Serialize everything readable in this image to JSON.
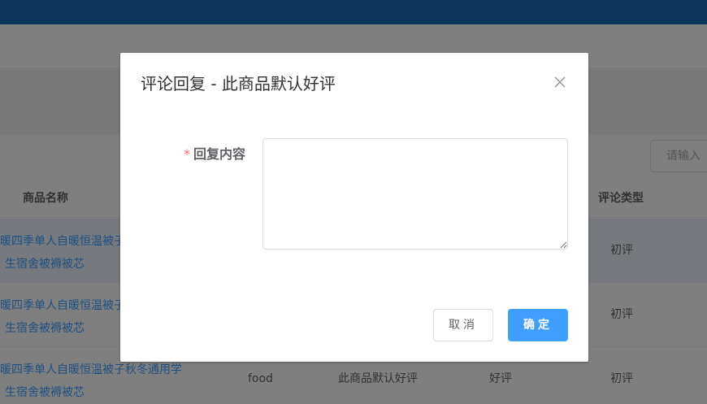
{
  "search": {
    "placeholder": "请输入"
  },
  "table": {
    "headers": {
      "product_name": "商品名称",
      "review_type": "评论类型"
    },
    "rows": [
      {
        "name_line1": "暖四季单人自暖恒温被子",
        "name_line2": "生宿舍被褥被芯",
        "category": "",
        "content": "",
        "rating": "",
        "review_type": "初评"
      },
      {
        "name_line1": "暖四季单人自暖恒温被子",
        "name_line2": "生宿舍被褥被芯",
        "category": "",
        "content": "",
        "rating": "",
        "review_type": "初评"
      },
      {
        "name_line1": "暖四季单人自暖恒温被子秋冬通用学",
        "name_line2": "生宿舍被褥被芯",
        "category": "food",
        "content": "此商品默认好评",
        "rating": "好评",
        "review_type": "初评"
      }
    ]
  },
  "dialog": {
    "title": "评论回复 - 此商品默认好评",
    "required_mark": "*",
    "field_label": "回复内容",
    "field_value": "",
    "cancel_label": "取消",
    "confirm_label": "确定"
  },
  "colors": {
    "topbar": "#1d6bb5",
    "primary": "#409eff",
    "required": "#f56c6c"
  },
  "icons": {
    "close": "close-icon"
  }
}
